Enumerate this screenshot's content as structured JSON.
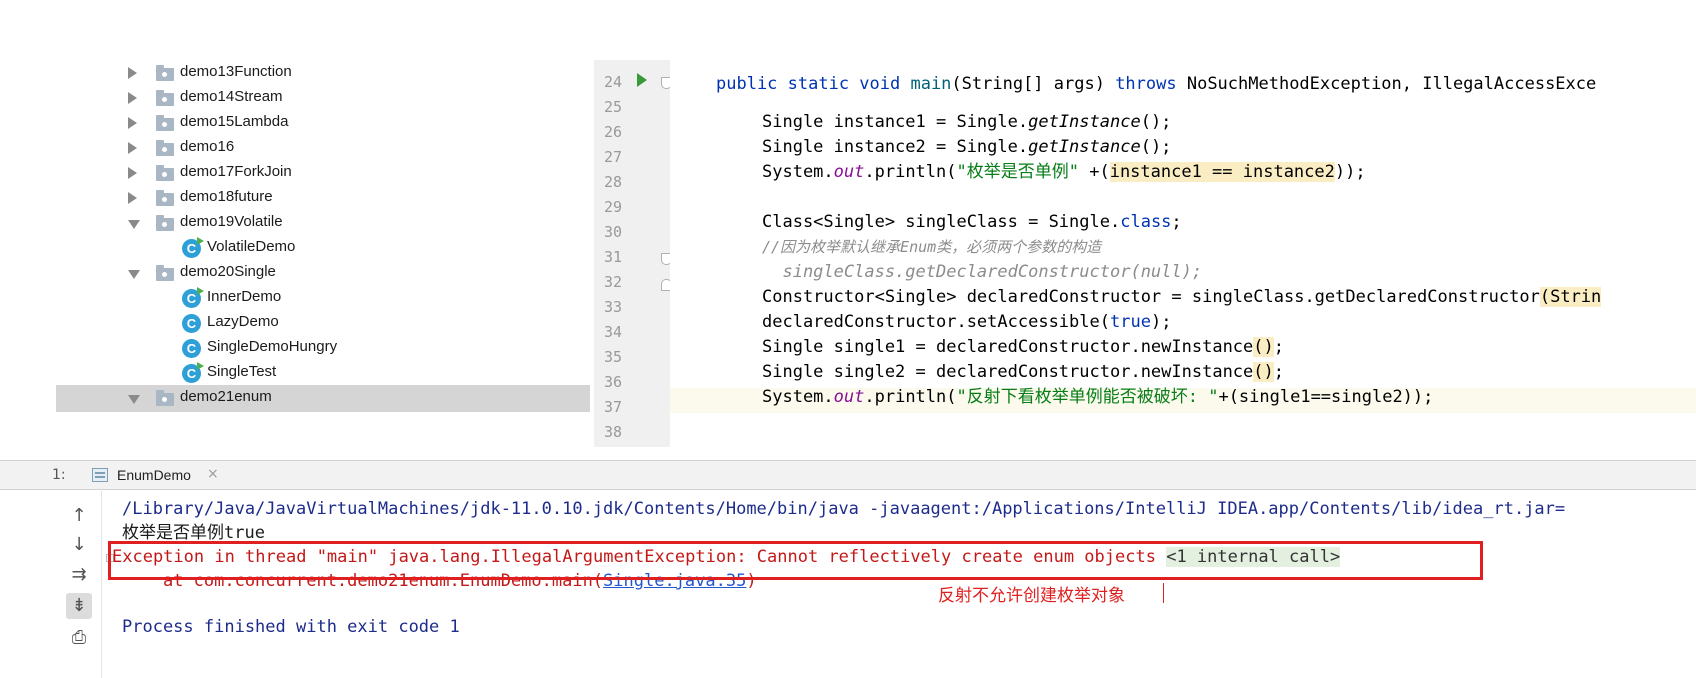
{
  "project_tree": {
    "items": [
      {
        "label": "demo13Function",
        "type": "folder",
        "expanded": false
      },
      {
        "label": "demo14Stream",
        "type": "folder",
        "expanded": false
      },
      {
        "label": "demo15Lambda",
        "type": "folder",
        "expanded": false
      },
      {
        "label": "demo16",
        "type": "folder",
        "expanded": false
      },
      {
        "label": "demo17ForkJoin",
        "type": "folder",
        "expanded": false
      },
      {
        "label": "demo18future",
        "type": "folder",
        "expanded": false
      },
      {
        "label": "demo19Volatile",
        "type": "folder",
        "expanded": true
      },
      {
        "label": "VolatileDemo",
        "type": "class",
        "runnable": true,
        "icon_letter": "C"
      },
      {
        "label": "demo20Single",
        "type": "folder",
        "expanded": true
      },
      {
        "label": "InnerDemo",
        "type": "class",
        "runnable": true,
        "icon_letter": "C"
      },
      {
        "label": "LazyDemo",
        "type": "class",
        "runnable": false,
        "icon_letter": "C"
      },
      {
        "label": "SingleDemoHungry",
        "type": "class",
        "runnable": false,
        "icon_letter": "C"
      },
      {
        "label": "SingleTest",
        "type": "class",
        "runnable": true,
        "icon_letter": "C"
      },
      {
        "label": "demo21enum",
        "type": "folder",
        "expanded": true,
        "selected": true
      }
    ]
  },
  "editor": {
    "line_numbers": [
      "24",
      "25",
      "26",
      "27",
      "28",
      "29",
      "30",
      "31",
      "32",
      "33",
      "34",
      "35",
      "36",
      "37",
      "38"
    ],
    "commented_marker": "//",
    "code": {
      "l24_a": "public static void ",
      "l24_b": "main",
      "l24_c": "(String[] args) ",
      "l24_d": "throws ",
      "l24_e": "NoSuchMethodException, IllegalAccessExce",
      "l26_a": "Single instance1 = Single.",
      "l26_b": "getInstance",
      "l26_c": "();",
      "l27_a": "Single instance2 = Single.",
      "l27_b": "getInstance",
      "l27_c": "();",
      "l28_a": "System.",
      "l28_b": "out",
      "l28_c": ".println(",
      "l28_d": "\"枚举是否单例\"",
      "l28_e": " +(",
      "l28_f": "instance1 == instance2",
      "l28_g": "));",
      "l30_a": "Class<Single> singleClass = Single.",
      "l30_b": "class",
      "l30_c": ";",
      "l31": "//因为枚举默认继承Enum类，必须两个参数的构造",
      "l32": "  singleClass.getDeclaredConstructor(null);",
      "l33_a": "Constructor<Single> declaredConstructor = singleClass.getDeclaredConstructor",
      "l33_b": "(Strin",
      "l34_a": "declaredConstructor.setAccessible(",
      "l34_b": "true",
      "l34_c": ");",
      "l35_a": "Single single1 = declaredConstructor.newInstance",
      "l35_b": "()",
      "l35_c": ";",
      "l36_a": "Single single2 = declaredConstructor.newInstance",
      "l36_b": "()",
      "l36_c": ";",
      "l37_a": "System.",
      "l37_b": "out",
      "l37_c": ".println(",
      "l37_d": "\"反射下看枚举单例能否被破坏: \"",
      "l37_e": "+(single1==single2));"
    }
  },
  "run_window": {
    "prefix": "1:",
    "tab_label": "EnumDemo",
    "tab_close": "×",
    "toolbar": {
      "up": "↑",
      "down": "↓",
      "wrap": "⇉",
      "scroll": "⇟",
      "print": "⎙"
    },
    "console": {
      "cmd": "/Library/Java/JavaVirtualMachines/jdk-11.0.10.jdk/Contents/Home/bin/java -javaagent:/Applications/IntelliJ IDEA.app/Contents/lib/idea_rt.jar=",
      "out1": "枚举是否单例true",
      "exception": "Exception in thread \"main\" java.lang.IllegalArgumentException: Cannot reflectively create enum objects ",
      "internal_call": "<1 internal call>",
      "at_prefix": "    at com.concurrent.demo21enum.EnumDemo.main(",
      "at_link": "Single.java:35",
      "at_suffix": ")",
      "exit": "Process finished with exit code 1"
    }
  },
  "annotation": {
    "text": "反射不允许创建枚举对象",
    "color": "#e02020"
  }
}
